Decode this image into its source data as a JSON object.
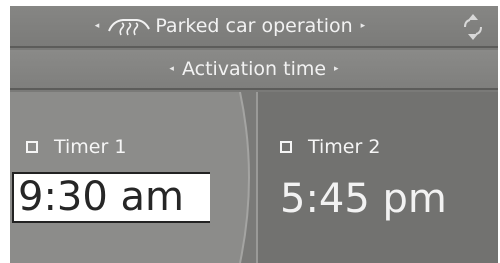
{
  "header": {
    "title": "Parked car operation",
    "left_arrow": "◂",
    "right_arrow": "▸",
    "car_icon": "parked-car-climate-icon",
    "scroll_icon": "rotary-controller-icon"
  },
  "subheader": {
    "title": "Activation time",
    "left_arrow": "◂",
    "right_arrow": "▸"
  },
  "timers": [
    {
      "label": "Timer 1",
      "time": "9:30 am",
      "selected": true
    },
    {
      "label": "Timer 2",
      "time": "5:45 pm",
      "selected": false
    }
  ],
  "colors": {
    "screen": "#7a7a78",
    "text": "#f2f2f2",
    "highlight_bg": "#ffffff",
    "highlight_text": "#262626"
  }
}
